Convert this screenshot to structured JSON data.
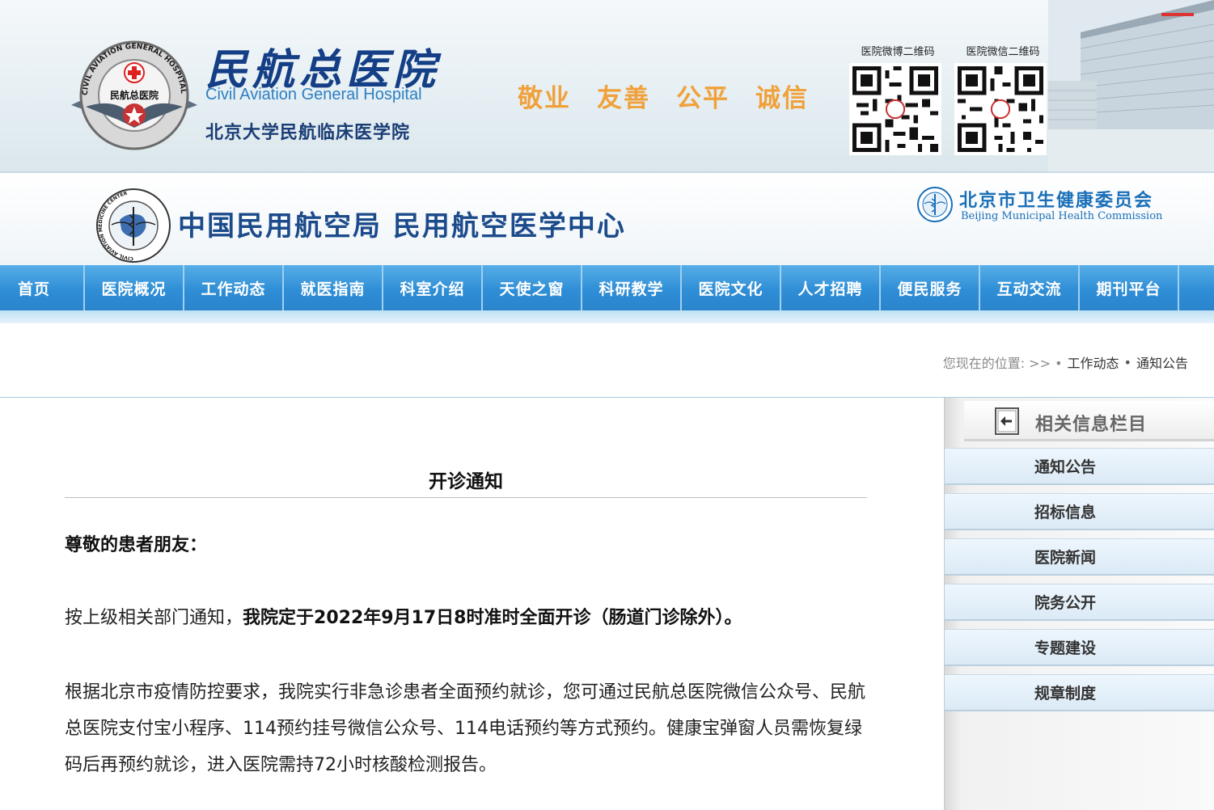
{
  "hospital": {
    "name_cn": "民航总医院",
    "name_en": "Civil Aviation General Hospital",
    "subtitle": "北京大学民航临床医学院",
    "emblem_ring_text": "CIVIL AVIATION GENERAL HOSPITAL",
    "emblem_center_text": "民航总医院"
  },
  "slogan": [
    "敬业",
    "友善",
    "公平",
    "诚信"
  ],
  "qr": {
    "weibo_label": "医院微博二维码",
    "wechat_label": "医院微信二维码"
  },
  "caac": {
    "title": "中国民用航空局 民用航空医学中心",
    "emblem_ring_text": "CIVIL AVIATION MEDICINE CENTER"
  },
  "bmhc": {
    "name_cn": "北京市卫生健康委员会",
    "name_en": "Beijing Municipal Health Commission"
  },
  "nav": {
    "items": [
      "首页",
      "医院概况",
      "工作动态",
      "就医指南",
      "科室介绍",
      "天使之窗",
      "科研教学",
      "医院文化",
      "人才招聘",
      "便民服务",
      "互动交流",
      "期刊平台"
    ]
  },
  "breadcrumb": {
    "prefix": "您现在的位置: >> •",
    "level1": "工作动态",
    "sep": "•",
    "level2": "通知公告"
  },
  "article": {
    "title": "开诊通知",
    "greeting": "尊敬的患者朋友：",
    "para1_lead": "按上级相关部门通知，",
    "para1_bold": "我院定于2022年9月17日8时准时全面开诊（肠道门诊除外）。",
    "para2": "根据北京市疫情防控要求，我院实行非急诊患者全面预约就诊，您可通过民航总医院微信公众号、民航总医院支付宝小程序、114预约挂号微信公众号、114电话预约等方式预约。健康宝弹窗人员需恢复绿码后再预约就诊，进入医院需持72小时核酸检测报告。"
  },
  "sidebar": {
    "title": "相关信息栏目",
    "items": [
      "通知公告",
      "招标信息",
      "医院新闻",
      "院务公开",
      "专题建设",
      "规章制度"
    ]
  },
  "colors": {
    "nav_blue": "#2f8ed6",
    "slogan_orange": "#f0a13b",
    "brand_navy": "#143f86"
  }
}
